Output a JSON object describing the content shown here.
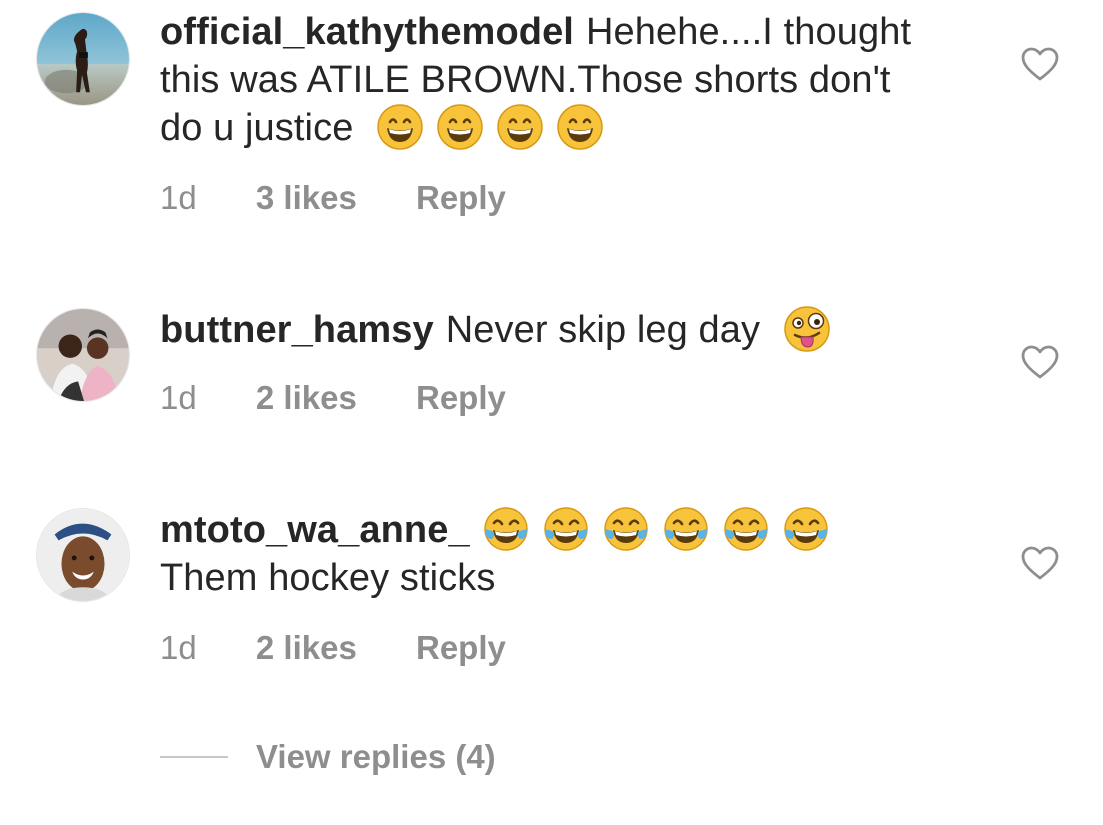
{
  "comments": [
    {
      "username": "official_kathythemodel",
      "text_before_emoji": "Hehehe....I thought this was ATILE  BROWN.Those shorts don't do u justice",
      "text_after_emoji": "",
      "emoji_name": "grinning-face-with-smiling-eyes",
      "emoji_count": 4,
      "time": "1d",
      "likes": "3 likes",
      "reply": "Reply",
      "avatar": "beach-photo"
    },
    {
      "username": "buttner_hamsy",
      "text_before_emoji": "Never skip leg day",
      "text_after_emoji": "",
      "emoji_name": "zany-face",
      "emoji_count": 1,
      "time": "1d",
      "likes": "2 likes",
      "reply": "Reply",
      "avatar": "couple-photo"
    },
    {
      "username": "mtoto_wa_anne_",
      "text_before_emoji": "",
      "text_after_emoji": "Them hockey sticks",
      "emoji_name": "face-with-tears-of-joy",
      "emoji_count": 6,
      "time": "1d",
      "likes": "2 likes",
      "reply": "Reply",
      "avatar": "portrait-photo"
    }
  ],
  "view_replies": "View replies (4)",
  "colors": {
    "text": "#262626",
    "secondary": "#8e8e8e",
    "divider": "#c7c7c7"
  }
}
